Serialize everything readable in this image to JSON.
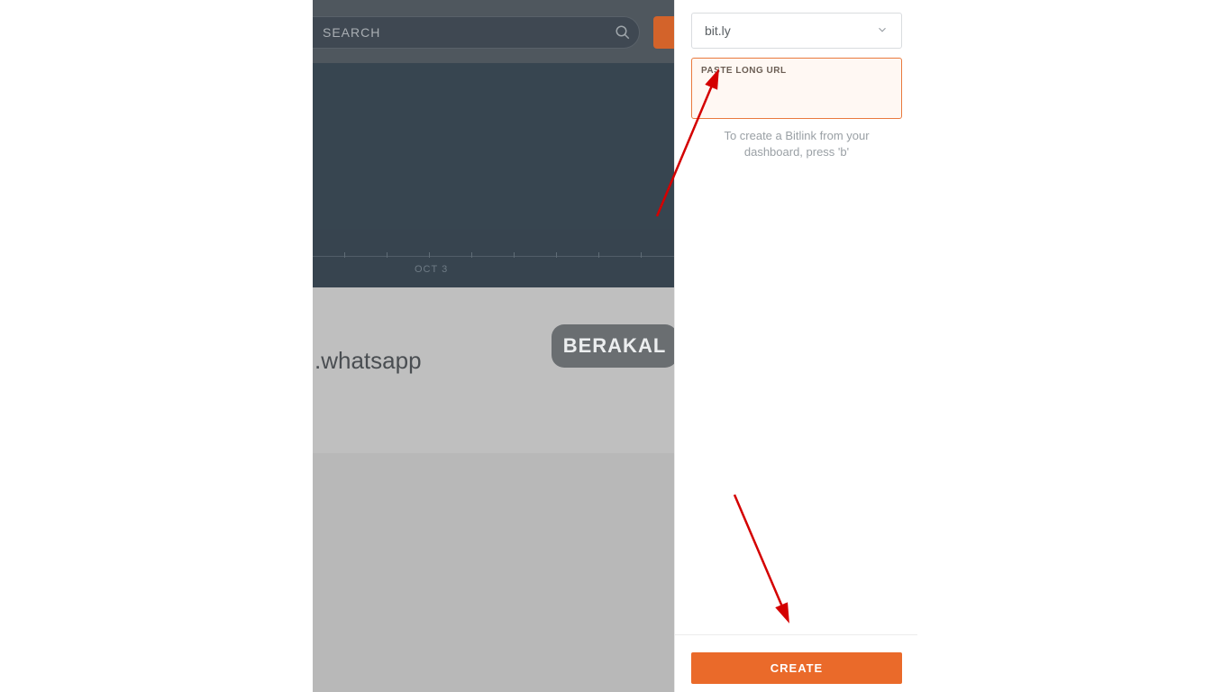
{
  "dashboard": {
    "search_placeholder": "SEARCH",
    "chart_month_label": "OCT 3",
    "link_title_fragment": ".whatsapp",
    "watermark_text": "BERAKAL"
  },
  "panel": {
    "domain_selected": "bit.ly",
    "url_input_label": "PASTE LONG URL",
    "url_input_value": "",
    "hint_line1": "To create a Bitlink from your",
    "hint_line2": "dashboard, press 'b'",
    "create_label": "CREATE"
  }
}
